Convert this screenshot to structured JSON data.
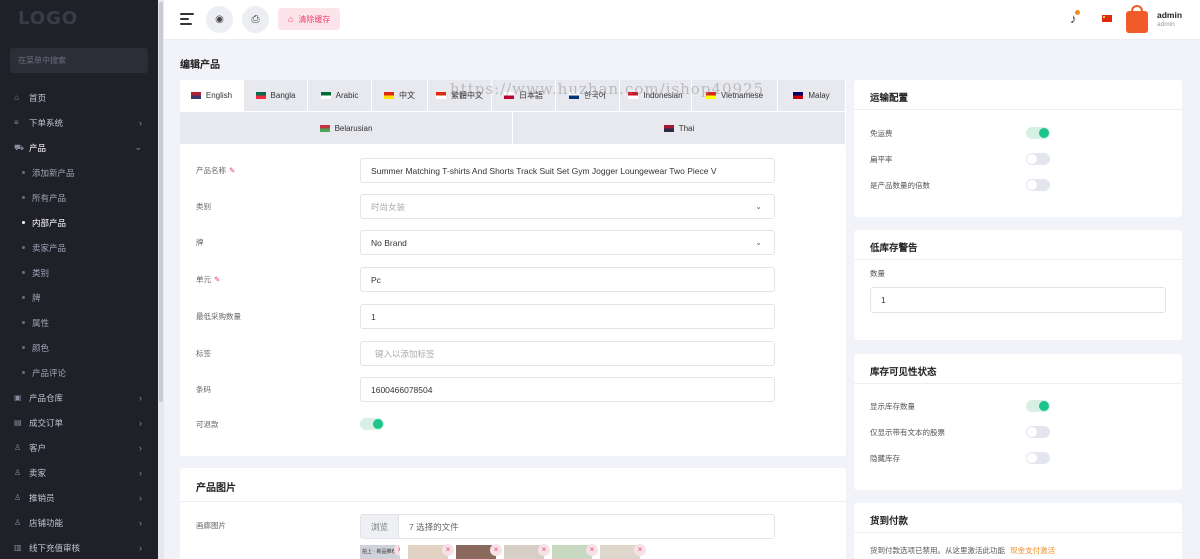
{
  "sidebar": {
    "logo": "LOGO",
    "search_placeholder": "在菜单中搜索",
    "items": [
      {
        "label": "首页",
        "icon": "home-icon",
        "glyph": "⌂",
        "chev": ""
      },
      {
        "label": "下单系统",
        "icon": "list-icon",
        "glyph": "≡",
        "chev": "›"
      },
      {
        "label": "产品",
        "icon": "cart-icon",
        "glyph": "⛟",
        "chev": "⌄"
      }
    ],
    "sub_items": [
      "添加新产品",
      "所有产品",
      "内部产品",
      "卖家产品",
      "类别",
      "牌",
      "属性",
      "颜色",
      "产品评论"
    ],
    "items2": [
      {
        "label": "产品仓库",
        "icon": "box-icon",
        "glyph": "▣",
        "chev": "›"
      },
      {
        "label": "成交订单",
        "icon": "orders-icon",
        "glyph": "▤",
        "chev": "›"
      },
      {
        "label": "客户",
        "icon": "users-icon",
        "glyph": "♙",
        "chev": "›"
      },
      {
        "label": "卖家",
        "icon": "seller-icon",
        "glyph": "♙",
        "chev": "›"
      },
      {
        "label": "推销员",
        "icon": "person-icon",
        "glyph": "♙",
        "chev": "›"
      },
      {
        "label": "店铺功能",
        "icon": "store-icon",
        "glyph": "♙",
        "chev": "›"
      },
      {
        "label": "线下充值审核",
        "icon": "recharge-icon",
        "glyph": "▥",
        "chev": "›"
      }
    ]
  },
  "header": {
    "clear_cache": "清除缓存",
    "user_name": "admin",
    "user_role": "admin"
  },
  "page_title": "编辑产品",
  "watermark": "https://www.huzhan.com/ishop40925",
  "languages": [
    {
      "label": "English",
      "c1": "#b22234",
      "c2": "#3c3b6e"
    },
    {
      "label": "Bangla",
      "c1": "#006a4e",
      "c2": "#f42a41"
    },
    {
      "label": "Arabic",
      "c1": "#006c35",
      "c2": "#ffffff"
    },
    {
      "label": "中文",
      "c1": "#de2910",
      "c2": "#ffde00"
    },
    {
      "label": "繁體中文",
      "c1": "#de2910",
      "c2": "#ffffff"
    },
    {
      "label": "日本語",
      "c1": "#ffffff",
      "c2": "#bc002d"
    },
    {
      "label": "한국어",
      "c1": "#ffffff",
      "c2": "#003478"
    },
    {
      "label": "Indonesian",
      "c1": "#ce1126",
      "c2": "#ffffff"
    },
    {
      "label": "Vietnamese",
      "c1": "#da251d",
      "c2": "#ffff00"
    },
    {
      "label": "Malay",
      "c1": "#010066",
      "c2": "#cc0001"
    }
  ],
  "languages2": [
    {
      "label": "Belarusian",
      "c1": "#c8313e",
      "c2": "#4aa657"
    },
    {
      "label": "Thai",
      "c1": "#a51931",
      "c2": "#2d2a4a"
    }
  ],
  "form": {
    "name_label": "产品名称",
    "name_value": "Summer Matching T-shirts And Shorts Track Suit Set Gym Jogger Loungewear Two Piece V",
    "category_label": "类别",
    "category_value": "时尚女装",
    "brand_label": "牌",
    "brand_value": "No Brand",
    "unit_label": "单元",
    "unit_value": "Pc",
    "min_qty_label": "最低采购数量",
    "min_qty_value": "1",
    "tags_label": "标签",
    "tags_placeholder": "键入以添加标签",
    "barcode_label": "条码",
    "barcode_value": "1600466078504",
    "refundable_label": "可退款",
    "refundable": true
  },
  "images": {
    "title": "产品图片",
    "gallery_label": "画廊图片",
    "browse": "浏览",
    "selected": "7 选择的文件",
    "thumb_caption": "拍上 · 新品推荐"
  },
  "shipping": {
    "title": "运输配置",
    "free_label": "免运费",
    "free": true,
    "flat_label": "扁平率",
    "flat": false,
    "qty_mult_label": "是产品数量的倍数",
    "qty_mult": false
  },
  "low_stock": {
    "title": "低库存警告",
    "qty_label": "数量",
    "qty_value": "1"
  },
  "visibility": {
    "title": "库存可见性状态",
    "show_qty_label": "显示库存数量",
    "show_qty": true,
    "text_only_label": "仅显示带有文本的股票",
    "text_only": false,
    "hide_label": "隐藏库存",
    "hide": false
  },
  "cod": {
    "title": "货到付款",
    "text": "货到付款选项已禁用。从这里激活此功能",
    "link": "现金支付激活"
  }
}
